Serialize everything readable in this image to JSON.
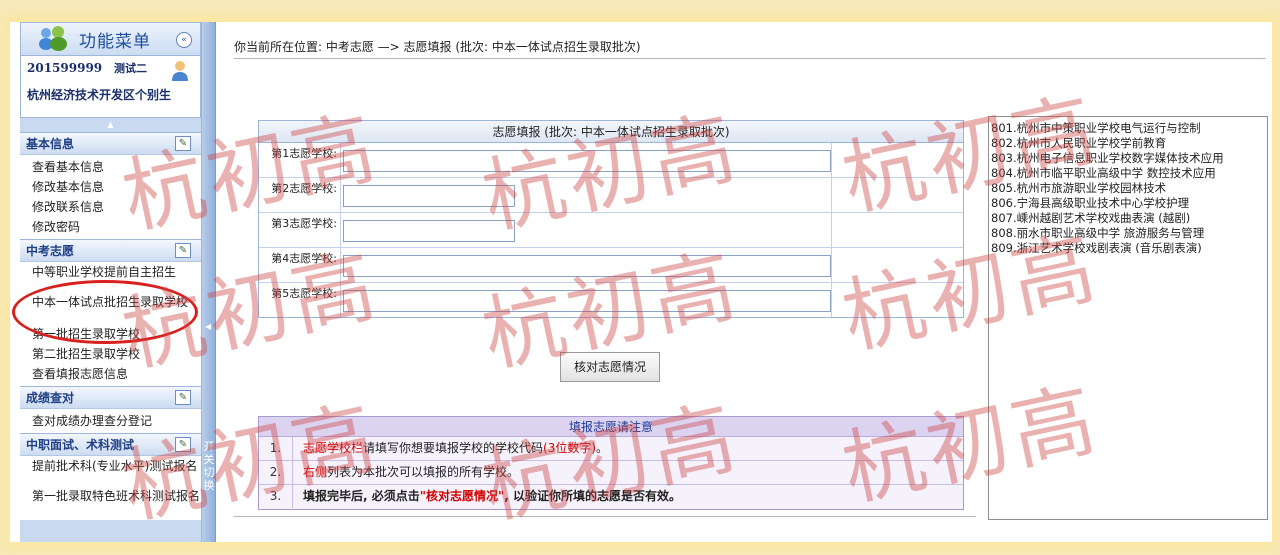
{
  "sidebar": {
    "title": "功能菜单",
    "collapse_glyph": "«",
    "user_id": "201599999",
    "user_name": "测试二",
    "school": "杭州经济技术开发区个别生",
    "scroll_up": "▲",
    "groups": [
      {
        "title": "基本信息",
        "items": [
          "查看基本信息",
          "修改基本信息",
          "修改联系信息",
          "修改密码"
        ]
      },
      {
        "title": "中考志愿",
        "items": [
          "中等职业学校提前自主招生",
          "中本一体试点批招生录取学校",
          "第一批招生录取学校",
          "第二批招生录取学校",
          "查看填报志愿信息"
        ]
      },
      {
        "title": "成绩查对",
        "items": [
          "查对成绩办理查分登记"
        ]
      },
      {
        "title": "中职面试、术科测试",
        "items": [
          "提前批术科(专业水平)测试报名",
          "第一批录取特色班术科测试报名"
        ]
      }
    ],
    "splitter_text": "开关切换",
    "splitter_arrow": "◀"
  },
  "main": {
    "breadcrumb": "你当前所在位置: 中考志愿   —> 志愿填报 (批次: 中本一体试点招生录取批次)",
    "form_caption": "志愿填报 (批次: 中本一体试点招生录取批次)",
    "rows": [
      {
        "label": "第1志愿学校:",
        "value": ""
      },
      {
        "label": "第2志愿学校:",
        "value": ""
      },
      {
        "label": "第3志愿学校:",
        "value": ""
      },
      {
        "label": "第4志愿学校:",
        "value": ""
      },
      {
        "label": "第5志愿学校:",
        "value": ""
      }
    ],
    "check_button": "核对志愿情况",
    "notes": {
      "caption": "填报志愿请注意",
      "items": [
        {
          "num": "1.",
          "red": "志愿学校栏",
          "text": "请填写你想要填报学校的学校代码",
          "red2": "(3位数字)",
          "tail": "。"
        },
        {
          "num": "2.",
          "red": "右侧",
          "text": "列表为本批次可以填报的所有学校。"
        },
        {
          "num": "3.",
          "lead": "填报完毕后, 必须点击",
          "red": "\"核对志愿情况\"",
          "tail": ", 以验证你所填的志愿是否有效。"
        }
      ]
    },
    "school_list": [
      "801.杭州市中策职业学校电气运行与控制",
      "802.杭州市人民职业学校学前教育",
      "803.杭州电子信息职业学校数字媒体技术应用",
      "804.杭州市临平职业高级中学 数控技术应用",
      "805.杭州市旅游职业学校园林技术",
      "806.宁海县高级职业技术中心学校护理",
      "807.嵊州越剧艺术学校戏曲表演 (越剧)",
      "808.丽水市职业高级中学 旅游服务与管理",
      "809.浙江艺术学校戏剧表演 (音乐剧表演)"
    ]
  },
  "watermark": "杭初高",
  "colors": {
    "accent": "#1f3f86",
    "oval": "#d8201e",
    "notes_red": "#d20000",
    "watermark": "#ce4646"
  },
  "icons": [
    "users-icon",
    "collapse-icon",
    "person-icon",
    "edit-icon"
  ]
}
